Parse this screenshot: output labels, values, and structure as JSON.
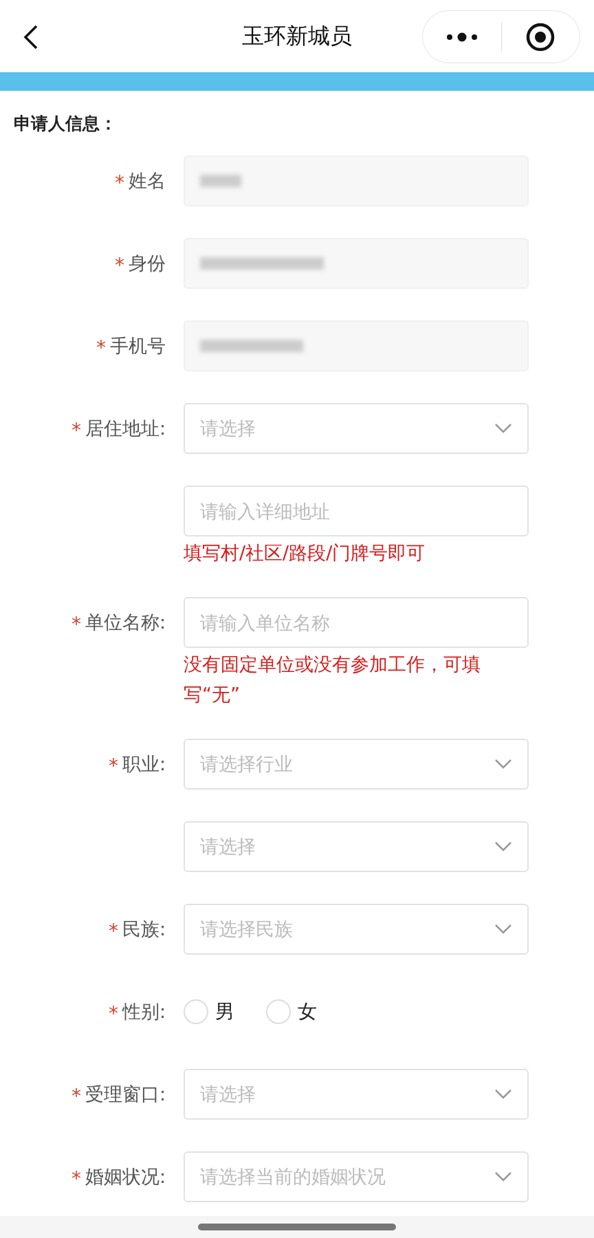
{
  "header": {
    "title": "玉环新城员"
  },
  "section_title": "申请人信息：",
  "fields": [
    {
      "kind": "masked",
      "mark": "*",
      "label": "姓名"
    },
    {
      "kind": "masked",
      "mark": "*",
      "label": "身份"
    },
    {
      "kind": "masked",
      "mark": "*",
      "label": "手机号"
    },
    {
      "kind": "select",
      "mark": "*",
      "label": "居住地址:",
      "placeholder": "请选择"
    },
    {
      "kind": "input",
      "placeholder": "请输入详细地址",
      "hint": "填写村/社区/路段/门牌号即可"
    },
    {
      "kind": "input",
      "mark": "*",
      "label": "单位名称:",
      "placeholder": "请输入单位名称",
      "hint": "没有固定单位或没有参加工作，可填写“无”"
    },
    {
      "kind": "select",
      "mark": "*",
      "label": "职业:",
      "placeholder": "请选择行业"
    },
    {
      "kind": "select",
      "placeholder": "请选择"
    },
    {
      "kind": "select",
      "mark": "*",
      "label": "民族:",
      "placeholder": "请选择民族"
    },
    {
      "kind": "radio",
      "mark": "*",
      "label": "性别:",
      "options": [
        {
          "label": "男",
          "selected": false
        },
        {
          "label": "女",
          "selected": false
        }
      ]
    },
    {
      "kind": "select",
      "mark": "*",
      "label": "受理窗口:",
      "placeholder": "请选择"
    },
    {
      "kind": "select",
      "mark": "*",
      "label": "婚姻状况:",
      "placeholder": "请选择当前的婚姻状况"
    }
  ]
}
